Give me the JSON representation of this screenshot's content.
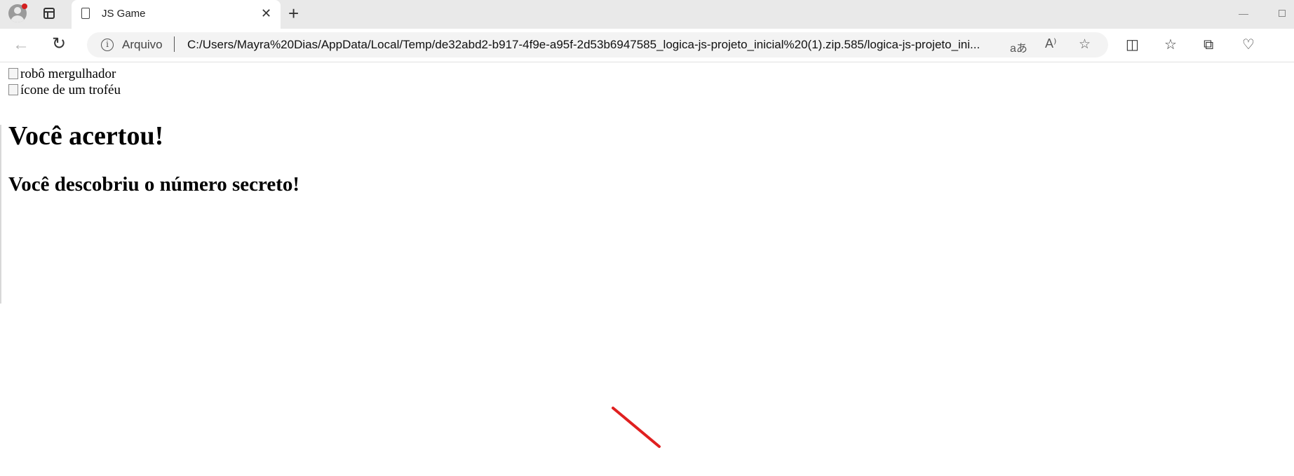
{
  "browser": {
    "tab": {
      "title": "JS Game",
      "close_icon": "close-icon"
    },
    "new_tab_icon": "plus-icon",
    "address": {
      "scheme_label": "Arquivo",
      "url": "C:/Users/Mayra%20Dias/AppData/Local/Temp/de32abd2-b917-4f9e-a95f-2d53b6947585_logica-js-projeto_inicial%20(1).zip.585/logica-js-projeto_ini..."
    },
    "icons": [
      "back-icon",
      "reload-icon",
      "info-icon",
      "translate-icon",
      "read-aloud-icon",
      "favorite-star-icon",
      "split-screen-icon",
      "favorites-icon",
      "collections-icon",
      "browser-essentials-icon"
    ],
    "colors": {
      "notification_dot": "#d41f1f",
      "annotation_stroke": "#e02020"
    }
  },
  "page": {
    "image1_alt": "robô mergulhador",
    "image2_alt": "ícone de um troféu",
    "heading": "Você acertou!",
    "paragraph": "Você descobriu o número secreto!"
  }
}
